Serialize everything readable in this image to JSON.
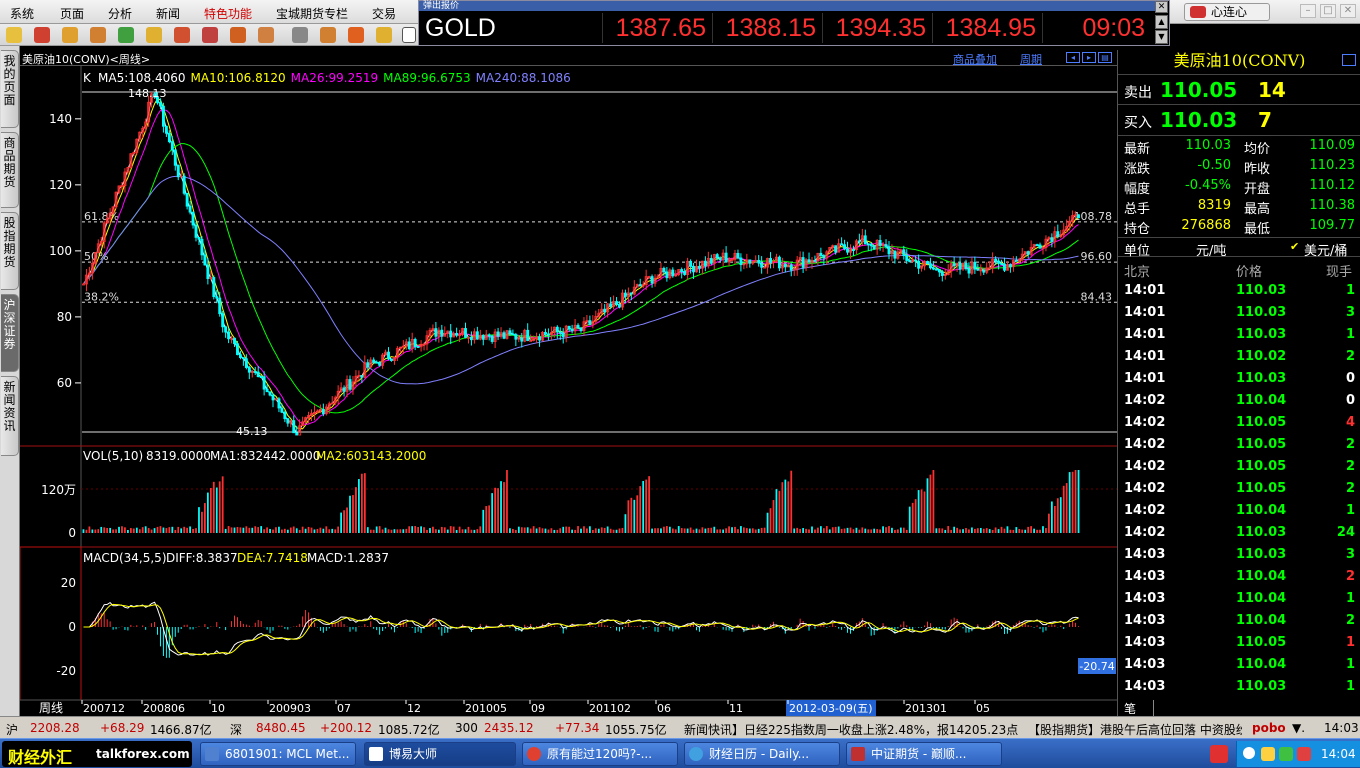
{
  "menu": [
    "系统",
    "页面",
    "分析",
    "新闻",
    "特色功能",
    "宝城期货专栏",
    "交易"
  ],
  "quote_bar": {
    "title": "弹出报价",
    "symbol": "GOLD",
    "cells": [
      "1387.65",
      "1388.15",
      "1394.35",
      "1384.95",
      "09:03"
    ]
  },
  "right_buttons": {
    "link": "心连心"
  },
  "left_nav": [
    "我的页面",
    "商品期货",
    "股指期货",
    "沪深证券",
    "新闻资讯"
  ],
  "chart_header": {
    "title": "美原油10(CONV)<周线>",
    "link1": "商品叠加",
    "link2": "周期"
  },
  "price_panel": {
    "k_label": "K",
    "ma_labels": [
      {
        "text": "MA5:108.4060",
        "color": "#ffffff"
      },
      {
        "text": "MA10:106.8120",
        "color": "#ffff00"
      },
      {
        "text": "MA26:99.2519",
        "color": "#ff00ff"
      },
      {
        "text": "MA89:96.6753",
        "color": "#00ff00"
      },
      {
        "text": "MA240:88.1086",
        "color": "#8080ff"
      }
    ],
    "high_label": "148.13",
    "low_label": "45.13",
    "y_ticks": [
      "140",
      "120",
      "100",
      "80",
      "60"
    ],
    "fib_labels": [
      "61.8%",
      "50%",
      "38.2%"
    ],
    "fib_values": [
      "108.78",
      "96.60",
      "84.43"
    ]
  },
  "vol_panel": {
    "title": "VOL(5,10)",
    "value": "8319.0000",
    "ma1": "MA1:832442.0000",
    "ma2": "MA2:603143.2000",
    "y_ticks": [
      "120万",
      "0"
    ]
  },
  "macd_panel": {
    "title": "MACD(34,5,5)",
    "diff": "DIFF:8.3837",
    "dea": "DEA:7.7418",
    "macd": "MACD:1.2837",
    "y_ticks": [
      "20",
      "0",
      "-20"
    ],
    "cursor_value": "-20.74"
  },
  "x_axis": {
    "label": "周线",
    "ticks": [
      "200712",
      "200806",
      "10",
      "200903",
      "07",
      "12",
      "201005",
      "09",
      "201102",
      "06",
      "11",
      "2012-03-09(五)",
      "201301",
      "05"
    ]
  },
  "chart_data": {
    "type": "candlestick",
    "instrument": "美原油10(CONV)",
    "period": "周线",
    "price_range": [
      45.13,
      148.13
    ],
    "price_keypoints": [
      {
        "x": "200712",
        "close": 90
      },
      {
        "x": "200806",
        "high": 148.13
      },
      {
        "x": "10",
        "close": 75
      },
      {
        "x": "200903",
        "low": 45.13
      },
      {
        "x": "07",
        "close": 65
      },
      {
        "x": "12",
        "close": 76
      },
      {
        "x": "201005",
        "close": 74
      },
      {
        "x": "09",
        "close": 76
      },
      {
        "x": "201102",
        "close": 92
      },
      {
        "x": "06",
        "close": 98
      },
      {
        "x": "11",
        "close": 96
      },
      {
        "x": "2012-03-09(五)",
        "close": 103
      },
      {
        "x": "201301",
        "close": 94
      },
      {
        "x": "05",
        "close": 96
      },
      {
        "x": "last",
        "close": 110.03
      }
    ],
    "fibonacci": [
      {
        "label": "61.8%",
        "value": 108.78
      },
      {
        "label": "50%",
        "value": 96.6
      },
      {
        "label": "38.2%",
        "value": 84.43
      }
    ],
    "moving_averages": {
      "MA5": 108.406,
      "MA10": 106.812,
      "MA26": 99.2519,
      "MA89": 96.6753,
      "MA240": 88.1086
    },
    "volume_peak": "120万",
    "macd": {
      "DIFF": 8.3837,
      "DEA": 7.7418,
      "MACD": 1.2837
    }
  },
  "side_panel": {
    "name": "美原油10(CONV)",
    "sell": {
      "label": "卖出",
      "price": "110.05",
      "volume": "14"
    },
    "buy": {
      "label": "买入",
      "price": "110.03",
      "volume": "7"
    },
    "stats": [
      {
        "l1": "最新",
        "v1": "110.03",
        "c1": "#00ff00",
        "l2": "均价",
        "v2": "110.09",
        "c2": "#00ff00"
      },
      {
        "l1": "涨跌",
        "v1": "-0.50",
        "c1": "#00ff00",
        "l2": "昨收",
        "v2": "110.23",
        "c2": "#00ff00"
      },
      {
        "l1": "幅度",
        "v1": "-0.45%",
        "c1": "#00ff00",
        "l2": "开盘",
        "v2": "110.12",
        "c2": "#00ff00"
      },
      {
        "l1": "总手",
        "v1": "8319",
        "c1": "#ffff00",
        "l2": "最高",
        "v2": "110.38",
        "c2": "#00ff00"
      },
      {
        "l1": "持仓",
        "v1": "276868",
        "c1": "#ffff00",
        "l2": "最低",
        "v2": "109.77",
        "c2": "#00ff00"
      }
    ],
    "unit_label": "单位",
    "unit_value": "元/吨",
    "unit_alt": "美元/桶",
    "tick_header": [
      "北京",
      "价格",
      "现手"
    ],
    "ticks": [
      {
        "t": "14:01",
        "p": "110.03",
        "v": "1",
        "vc": "#00ff00"
      },
      {
        "t": "14:01",
        "p": "110.03",
        "v": "3",
        "vc": "#00ff00"
      },
      {
        "t": "14:01",
        "p": "110.03",
        "v": "1",
        "vc": "#00ff00"
      },
      {
        "t": "14:01",
        "p": "110.02",
        "v": "2",
        "vc": "#00ff00"
      },
      {
        "t": "14:01",
        "p": "110.03",
        "v": "0",
        "vc": "#ffffff"
      },
      {
        "t": "14:02",
        "p": "110.04",
        "v": "0",
        "vc": "#ffffff"
      },
      {
        "t": "14:02",
        "p": "110.05",
        "v": "4",
        "vc": "#ff3030"
      },
      {
        "t": "14:02",
        "p": "110.05",
        "v": "2",
        "vc": "#00ff00"
      },
      {
        "t": "14:02",
        "p": "110.05",
        "v": "2",
        "vc": "#00ff00"
      },
      {
        "t": "14:02",
        "p": "110.05",
        "v": "2",
        "vc": "#00ff00"
      },
      {
        "t": "14:02",
        "p": "110.04",
        "v": "1",
        "vc": "#00ff00"
      },
      {
        "t": "14:02",
        "p": "110.03",
        "v": "24",
        "vc": "#00ff00"
      },
      {
        "t": "14:03",
        "p": "110.03",
        "v": "3",
        "vc": "#00ff00"
      },
      {
        "t": "14:03",
        "p": "110.04",
        "v": "2",
        "vc": "#ff3030"
      },
      {
        "t": "14:03",
        "p": "110.04",
        "v": "1",
        "vc": "#00ff00"
      },
      {
        "t": "14:03",
        "p": "110.04",
        "v": "2",
        "vc": "#00ff00"
      },
      {
        "t": "14:03",
        "p": "110.05",
        "v": "1",
        "vc": "#ff3030"
      },
      {
        "t": "14:03",
        "p": "110.04",
        "v": "1",
        "vc": "#00ff00"
      },
      {
        "t": "14:03",
        "p": "110.03",
        "v": "1",
        "vc": "#00ff00"
      }
    ],
    "footer_tab": "笔"
  },
  "status_bar": {
    "sh_label": "沪",
    "sh_val": "2208.28",
    "sh_chg": "+68.29",
    "sh_amt": "1466.87亿",
    "sz_label": "深",
    "sz_val": "8480.45",
    "sz_chg": "+200.12",
    "sz_amt": "1085.72亿",
    "i300_label": "300",
    "i300_val": "2435.12",
    "i300_chg": "+77.34",
    "i300_amt": "1055.75亿",
    "news": "新闻快讯】日经225指数周一收盘上涨2.48%，报14205.23点",
    "news2": "【股指期货】港股午后高位回落 中资股纷",
    "brand": "pobo",
    "time": "14:03"
  },
  "taskbar": {
    "logo": "财经外汇",
    "logo2": "talkforex.com",
    "items": [
      "6801901: MCL Met...",
      "博易大师",
      "原有能过120吗?-...",
      "财经日历 - Daily...",
      "中证期货 - 巅顺..."
    ],
    "clock": "14:04"
  }
}
